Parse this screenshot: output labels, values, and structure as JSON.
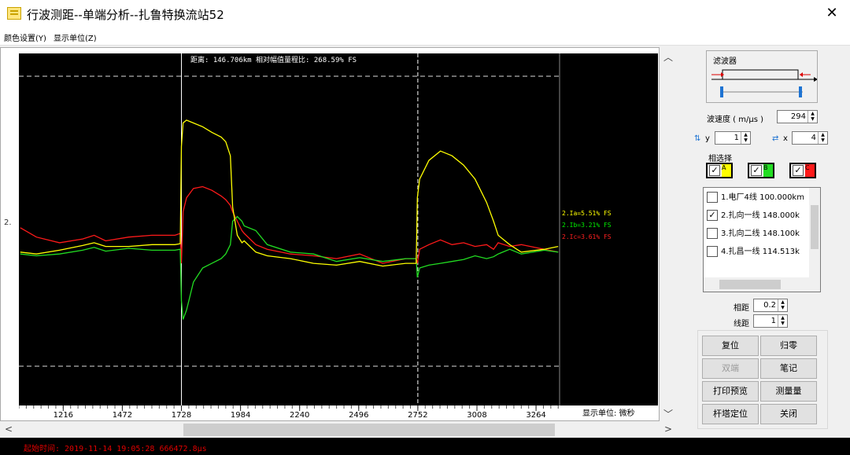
{
  "window": {
    "title": "行波测距--单端分析--扎鲁特换流站52",
    "close": "✕"
  },
  "menu": {
    "items": [
      "颜色设置(Y)",
      "显示单位(Z)"
    ]
  },
  "plot": {
    "header": "距离: 146.706km  相对幅值量程比: 268.59% FS",
    "side_index": "2.",
    "unit_label": "显示单位: 微秒",
    "x_ticks": [
      "1216",
      "1472",
      "1728",
      "1984",
      "2240",
      "2496",
      "2752",
      "3008",
      "3264"
    ],
    "legend": [
      {
        "text": "2.Ia=5.51% FS",
        "color": "#ffff00"
      },
      {
        "text": "2.Ib=3.21% FS",
        "color": "#00ee00"
      },
      {
        "text": "2.Ic=3.61% FS",
        "color": "#ff2020"
      }
    ],
    "colors": {
      "a": "#ffff00",
      "b": "#22dd22",
      "c": "#ff1a1a",
      "background": "#000000",
      "cursor": "#ffffff"
    }
  },
  "chart_data": {
    "type": "line",
    "xlabel": "显示单位: 微秒",
    "xlim": [
      1024,
      3366
    ],
    "x": [
      1030,
      1100,
      1200,
      1300,
      1350,
      1400,
      1500,
      1600,
      1700,
      1723,
      1728,
      1735,
      1750,
      1780,
      1820,
      1860,
      1900,
      1920,
      1940,
      1950,
      1970,
      1990,
      2000,
      2050,
      2100,
      2200,
      2300,
      2400,
      2500,
      2600,
      2700,
      2745,
      2750,
      2760,
      2800,
      2850,
      2900,
      2950,
      3000,
      3050,
      3080,
      3100,
      3150,
      3200,
      3300,
      3360
    ],
    "series": [
      {
        "name": "2.Ia=5.51% FS",
        "values": [
          0.22,
          0.2,
          0.24,
          0.29,
          0.32,
          0.28,
          0.28,
          0.3,
          0.3,
          0.31,
          1.35,
          1.6,
          1.63,
          1.6,
          1.56,
          1.5,
          1.45,
          1.4,
          1.25,
          0.7,
          0.4,
          0.32,
          0.34,
          0.22,
          0.18,
          0.15,
          0.1,
          0.08,
          0.12,
          0.07,
          0.1,
          0.1,
          0.8,
          1.0,
          1.2,
          1.3,
          1.25,
          1.15,
          1.0,
          0.75,
          0.55,
          0.4,
          0.3,
          0.22,
          0.25,
          0.28
        ]
      },
      {
        "name": "2.Ib=3.21% FS",
        "values": [
          0.2,
          0.18,
          0.2,
          0.24,
          0.27,
          0.23,
          0.26,
          0.24,
          0.24,
          0.25,
          -0.3,
          -0.5,
          -0.4,
          -0.1,
          0.05,
          0.1,
          0.15,
          0.2,
          0.3,
          0.55,
          0.6,
          0.55,
          0.5,
          0.45,
          0.3,
          0.22,
          0.2,
          0.12,
          0.16,
          0.12,
          0.15,
          0.15,
          -0.05,
          0.05,
          0.08,
          0.1,
          0.12,
          0.14,
          0.18,
          0.15,
          0.17,
          0.2,
          0.25,
          0.2,
          0.24,
          0.22
        ]
      },
      {
        "name": "2.Ic=3.61% FS",
        "values": [
          0.48,
          0.38,
          0.32,
          0.36,
          0.4,
          0.34,
          0.38,
          0.4,
          0.4,
          0.42,
          0.1,
          0.65,
          0.8,
          0.9,
          0.92,
          0.88,
          0.82,
          0.78,
          0.72,
          0.65,
          0.55,
          0.45,
          0.42,
          0.3,
          0.25,
          0.2,
          0.18,
          0.15,
          0.2,
          0.1,
          0.15,
          0.15,
          0.1,
          0.25,
          0.3,
          0.35,
          0.3,
          0.32,
          0.28,
          0.3,
          0.25,
          0.32,
          0.28,
          0.3,
          0.25,
          0.22
        ]
      }
    ],
    "ylim": [
      -1.0,
      2.1
    ],
    "cursor_lines": [
      1728,
      2752
    ]
  },
  "filter": {
    "title": "滤波器"
  },
  "controls": {
    "speed_label": "波速度 ( m/μs )",
    "speed_value": "294",
    "y_label": "y",
    "y_value": "1",
    "x_label": "x",
    "x_value": "4",
    "phase_title": "相选择",
    "phases": [
      {
        "label": "A",
        "color": "#ffff00"
      },
      {
        "label": "B",
        "color": "#22dd22"
      },
      {
        "label": "C",
        "color": "#ff1a1a"
      }
    ],
    "phase_gap_label": "相距",
    "phase_gap_value": "0.2",
    "line_gap_label": "线距",
    "line_gap_value": "1"
  },
  "lines": [
    {
      "text": "1.电厂4线  100.000km",
      "checked": false
    },
    {
      "text": "2.扎向一线  148.000k",
      "checked": true
    },
    {
      "text": "3.扎向二线  148.100k",
      "checked": false
    },
    {
      "text": "4.扎昌一线  114.513k",
      "checked": false
    }
  ],
  "buttons": {
    "reset": "复位",
    "zero": "归零",
    "double_end": "双端",
    "note": "笔记",
    "print_preview": "打印预览",
    "measure": "测量量",
    "tower_locate": "杆塔定位",
    "close": "关闭"
  },
  "status": {
    "text": "起始时间: 2019-11-14 19:05:28 666472.8μs"
  }
}
